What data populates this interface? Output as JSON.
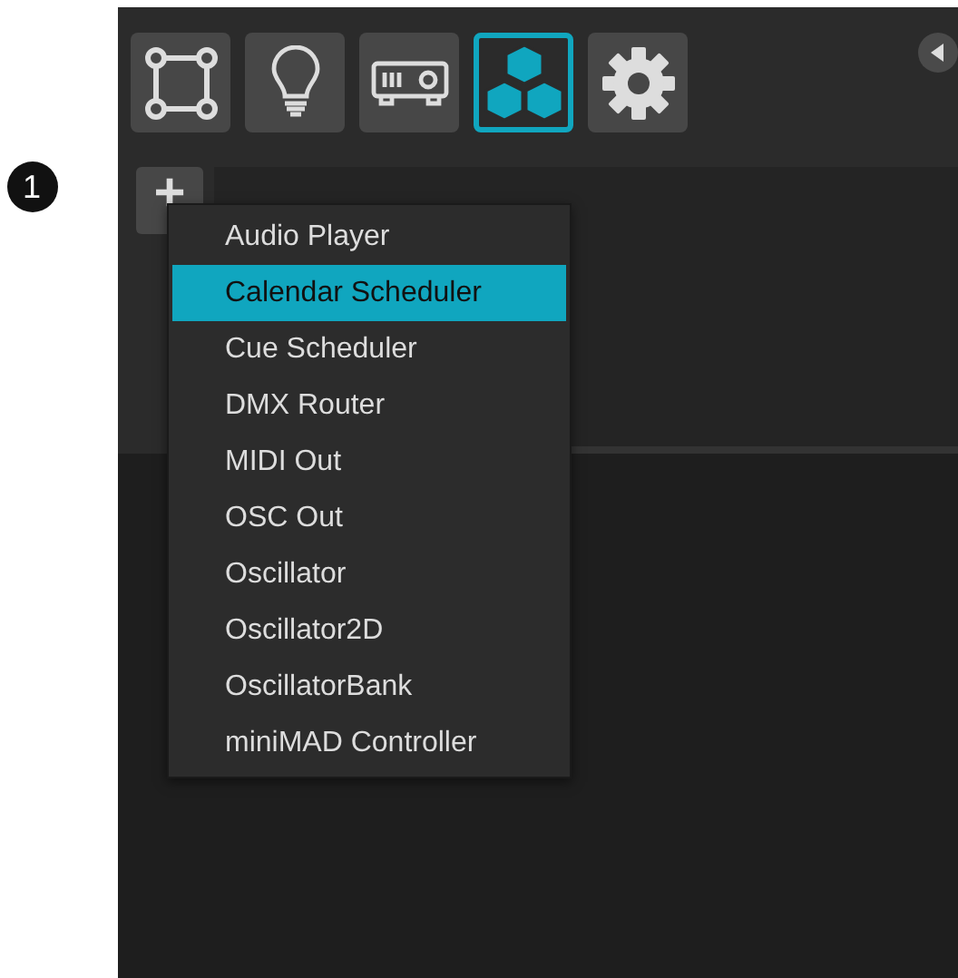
{
  "callout": "1",
  "toolbar": [
    {
      "kind": "quad",
      "selected": false
    },
    {
      "kind": "bulb",
      "selected": false
    },
    {
      "kind": "projector",
      "selected": false
    },
    {
      "kind": "cubes",
      "selected": true
    },
    {
      "kind": "gear",
      "selected": false
    }
  ],
  "add_button": {
    "label": "+"
  },
  "menu": [
    {
      "label": "Audio Player",
      "selected": false
    },
    {
      "label": "Calendar Scheduler",
      "selected": true
    },
    {
      "label": "Cue Scheduler",
      "selected": false
    },
    {
      "label": "DMX Router",
      "selected": false
    },
    {
      "label": "MIDI Out",
      "selected": false
    },
    {
      "label": "OSC Out",
      "selected": false
    },
    {
      "label": "Oscillator",
      "selected": false
    },
    {
      "label": "Oscillator2D",
      "selected": false
    },
    {
      "label": "OscillatorBank",
      "selected": false
    },
    {
      "label": "miniMAD Controller",
      "selected": false
    }
  ]
}
